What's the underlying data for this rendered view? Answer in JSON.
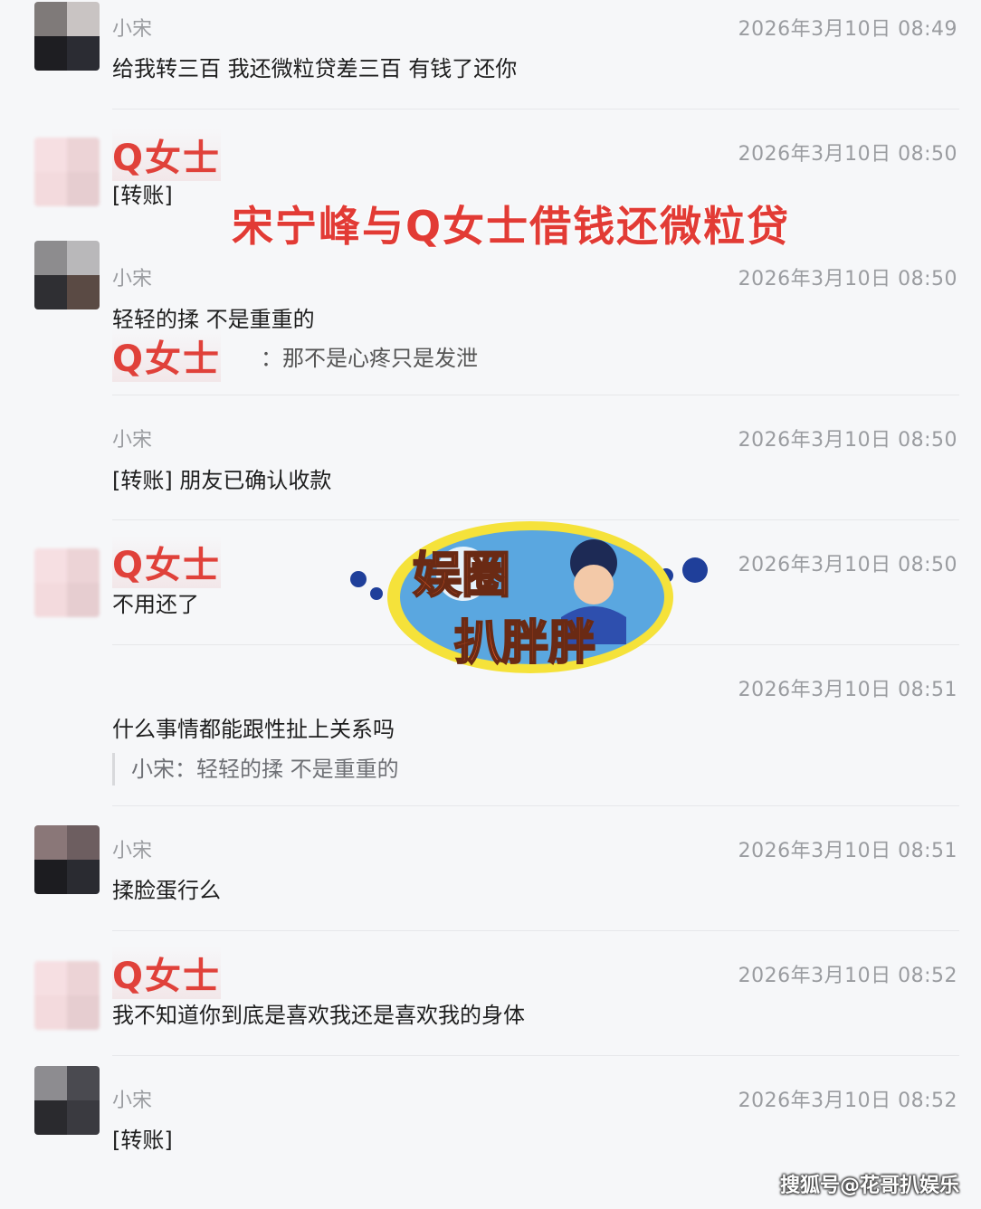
{
  "title_overlay": "宋宁峰与Q女士借钱还微粒贷",
  "messages": [
    {
      "sender": "小宋",
      "time": "2026年3月10日 08:49",
      "text": "给我转三百 我还微粒贷差三百 有钱了还你"
    },
    {
      "sender": "Q女士",
      "time": "2026年3月10日 08:50",
      "text": "[转账]"
    },
    {
      "sender": "小宋",
      "time": "2026年3月10日 08:50",
      "text": "轻轻的揉 不是重重的"
    },
    {
      "sender": "小宋",
      "time": "2026年3月10日 08:50",
      "text": "[转账] 朋友已确认收款"
    },
    {
      "sender": "Q女士",
      "time": "2026年3月10日 08:50",
      "text": "不用还了"
    },
    {
      "sender": "",
      "time": "2026年3月10日 08:51",
      "text": "什么事情都能跟性扯上关系吗"
    },
    {
      "sender": "小宋",
      "time": "2026年3月10日 08:51",
      "text": "揉脸蛋行么"
    },
    {
      "sender": "Q女士",
      "time": "2026年3月10日 08:52",
      "text": "我不知道你到底是喜欢我还是喜欢我的身体"
    },
    {
      "sender": "小宋",
      "time": "2026年3月10日 08:52",
      "text": "[转账]"
    }
  ],
  "reply": {
    "name": "Q女士",
    "text": "：那不是心疼只是发泄"
  },
  "quote": {
    "text": "小宋：轻轻的揉 不是重重的"
  },
  "logo": {
    "line1": "娱圈",
    "line2": "扒胖胖"
  },
  "watermark": "搜狐号@花哥扒娱乐",
  "colors": {
    "accent_red": "#e0413a",
    "logo_blue": "#5aa7e0",
    "logo_yellow": "#f5e23a",
    "logo_orange": "#f0602c"
  }
}
